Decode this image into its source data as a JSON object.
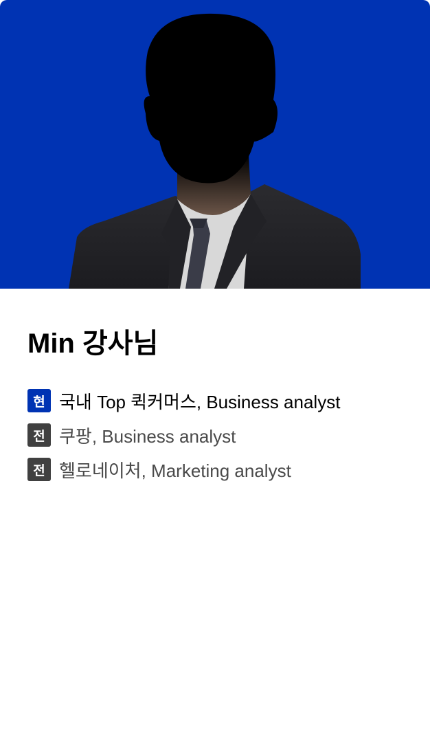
{
  "profile": {
    "name": "Min 강사님",
    "photo_icon": "person-silhouette-suit",
    "background_color": "#0033b3"
  },
  "career": [
    {
      "badge": "현",
      "text": "국내 Top 퀵커머스, Business analyst",
      "status": "current",
      "badge_color": "#0033b3"
    },
    {
      "badge": "전",
      "text": "쿠팡, Business analyst",
      "status": "former",
      "badge_color": "#404040"
    },
    {
      "badge": "전",
      "text": "헬로네이처, Marketing analyst",
      "status": "former",
      "badge_color": "#404040"
    }
  ]
}
